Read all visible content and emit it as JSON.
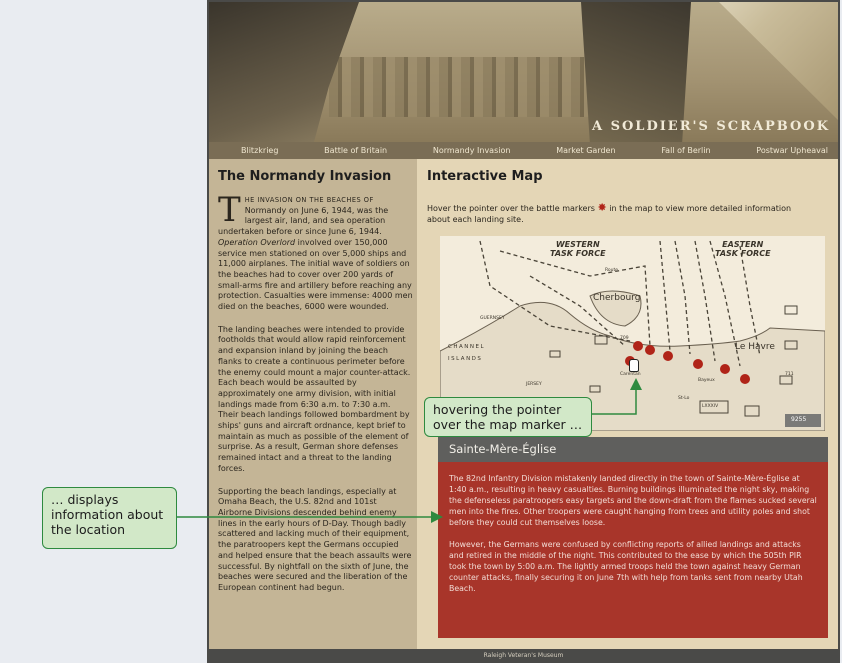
{
  "banner": {
    "title": "A SOLDIER'S SCRAPBOOK"
  },
  "nav": [
    "Blitzkrieg",
    "Battle of Britain",
    "Normandy Invasion",
    "Market Garden",
    "Fall of Berlin",
    "Postwar Upheaval"
  ],
  "sidebar": {
    "heading": "The Normandy Invasion",
    "dropcap": "T",
    "para1_caps": "HE INVASION ON THE BEACHES OF",
    "para1_a": "Normandy on June 6, 1944, was the largest air, land, and sea operation undertaken before or since June 6, 1944.",
    "para1_em": "Operation Overlord",
    "para1_b": "involved over 150,000 service men stationed on over 5,000 ships and 11,000 airplanes. The initial wave of soldiers on the beaches had to cover over 200 yards of small-arms fire and artillery before reaching any protection. Casualties were immense: 4000 men died on the beaches, 6000 were wounded.",
    "para2": "The landing beaches were intended to provide footholds that would allow rapid reinforcement and expansion inland by joining the beach flanks to create a continuous perimeter before the enemy could mount a major counter-attack. Each beach would be assaulted by approximately one army division, with initial landings made from 6:30 a.m. to 7:30 a.m. Their beach landings followed bombardment by ships' guns and aircraft ordnance, kept brief to maintain as much as possible of the element of surprise. As a result, German shore defenses remained intact and a threat to the landing forces.",
    "para3": "Supporting the beach landings, especially at Omaha Beach, the U.S. 82nd and 101st Airborne Divisions descended behind enemy lines in the early hours of D-Day. Though badly scattered and lacking much of their equipment, the paratroopers kept the Germans occupied and helped ensure that the beach assaults were successful. By nightfall on the sixth of June, the beaches were secured and the liberation of the European continent had begun."
  },
  "main": {
    "heading": "Interactive Map",
    "intro_a": "Hover the pointer over the battle markers",
    "intro_b": "in the map to view more detailed information about each landing site."
  },
  "map": {
    "western": "WESTERN",
    "western2": "TASK FORCE",
    "eastern": "EASTERN",
    "eastern2": "TASK FORCE",
    "cherbourg": "Cherbourg",
    "le_havre": "Le Havre",
    "channel": "CHANNEL",
    "islands": "ISLANDS",
    "jersey": "JERSEY",
    "guernsey": "GUERNSEY",
    "carentan": "Carentan",
    "bayeux": "Bayeux",
    "st_lo": "St-Lo",
    "route": "Route",
    "lxxxiv": "LXXXIV",
    "num1": "711",
    "num2": "709",
    "num3": "9255"
  },
  "info": {
    "title": "Sainte-Mère-Église",
    "p1": "The 82nd Infantry Division mistakenly landed directly in the town of Sainte-Mère-Église at 1:40 a.m., resulting in heavy casualties. Burning buildings illuminated the night sky, making the defenseless paratroopers easy targets and the down-draft from the flames sucked several men into the fires. Other troopers were caught hanging from trees and utility poles and shot before they could cut themselves loose.",
    "p2": "However, the Germans were confused by conflicting reports of allied landings and attacks and retired in the middle of the night. This contributed to the ease by which the 505th PIR took the town by 5:00 a.m. The lightly armed troops held the town against heavy German counter attacks, finally securing it on June 7th with help from tanks sent from nearby Utah Beach."
  },
  "footer": "Raleigh Veteran's Museum",
  "callouts": {
    "hover": "hovering the pointer over the map marker …",
    "displays": "… displays information about the location"
  },
  "colors": {
    "marker": "#b02418",
    "callout_border": "#2e8a3f",
    "info_bg": "#a8352a"
  }
}
